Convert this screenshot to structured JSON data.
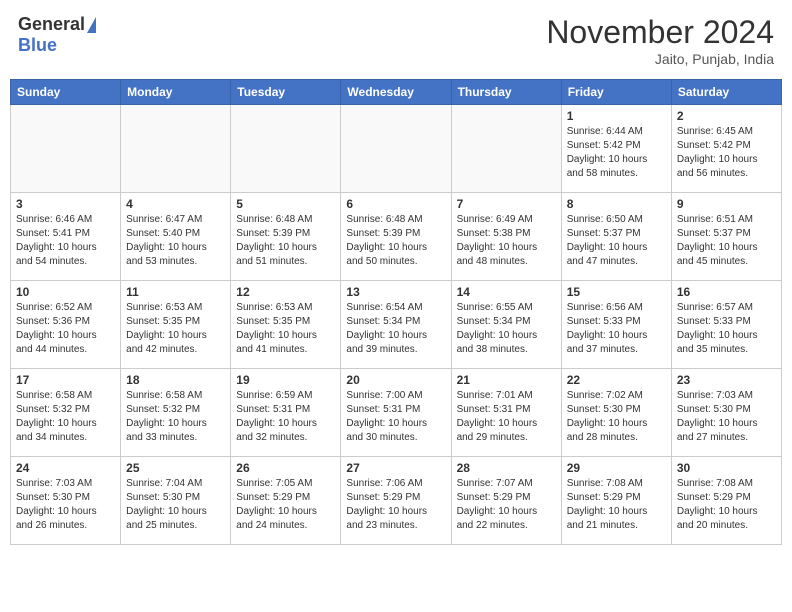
{
  "header": {
    "logo_general": "General",
    "logo_blue": "Blue",
    "month_title": "November 2024",
    "location": "Jaito, Punjab, India"
  },
  "weekdays": [
    "Sunday",
    "Monday",
    "Tuesday",
    "Wednesday",
    "Thursday",
    "Friday",
    "Saturday"
  ],
  "weeks": [
    [
      {
        "day": "",
        "info": ""
      },
      {
        "day": "",
        "info": ""
      },
      {
        "day": "",
        "info": ""
      },
      {
        "day": "",
        "info": ""
      },
      {
        "day": "",
        "info": ""
      },
      {
        "day": "1",
        "info": "Sunrise: 6:44 AM\nSunset: 5:42 PM\nDaylight: 10 hours\nand 58 minutes."
      },
      {
        "day": "2",
        "info": "Sunrise: 6:45 AM\nSunset: 5:42 PM\nDaylight: 10 hours\nand 56 minutes."
      }
    ],
    [
      {
        "day": "3",
        "info": "Sunrise: 6:46 AM\nSunset: 5:41 PM\nDaylight: 10 hours\nand 54 minutes."
      },
      {
        "day": "4",
        "info": "Sunrise: 6:47 AM\nSunset: 5:40 PM\nDaylight: 10 hours\nand 53 minutes."
      },
      {
        "day": "5",
        "info": "Sunrise: 6:48 AM\nSunset: 5:39 PM\nDaylight: 10 hours\nand 51 minutes."
      },
      {
        "day": "6",
        "info": "Sunrise: 6:48 AM\nSunset: 5:39 PM\nDaylight: 10 hours\nand 50 minutes."
      },
      {
        "day": "7",
        "info": "Sunrise: 6:49 AM\nSunset: 5:38 PM\nDaylight: 10 hours\nand 48 minutes."
      },
      {
        "day": "8",
        "info": "Sunrise: 6:50 AM\nSunset: 5:37 PM\nDaylight: 10 hours\nand 47 minutes."
      },
      {
        "day": "9",
        "info": "Sunrise: 6:51 AM\nSunset: 5:37 PM\nDaylight: 10 hours\nand 45 minutes."
      }
    ],
    [
      {
        "day": "10",
        "info": "Sunrise: 6:52 AM\nSunset: 5:36 PM\nDaylight: 10 hours\nand 44 minutes."
      },
      {
        "day": "11",
        "info": "Sunrise: 6:53 AM\nSunset: 5:35 PM\nDaylight: 10 hours\nand 42 minutes."
      },
      {
        "day": "12",
        "info": "Sunrise: 6:53 AM\nSunset: 5:35 PM\nDaylight: 10 hours\nand 41 minutes."
      },
      {
        "day": "13",
        "info": "Sunrise: 6:54 AM\nSunset: 5:34 PM\nDaylight: 10 hours\nand 39 minutes."
      },
      {
        "day": "14",
        "info": "Sunrise: 6:55 AM\nSunset: 5:34 PM\nDaylight: 10 hours\nand 38 minutes."
      },
      {
        "day": "15",
        "info": "Sunrise: 6:56 AM\nSunset: 5:33 PM\nDaylight: 10 hours\nand 37 minutes."
      },
      {
        "day": "16",
        "info": "Sunrise: 6:57 AM\nSunset: 5:33 PM\nDaylight: 10 hours\nand 35 minutes."
      }
    ],
    [
      {
        "day": "17",
        "info": "Sunrise: 6:58 AM\nSunset: 5:32 PM\nDaylight: 10 hours\nand 34 minutes."
      },
      {
        "day": "18",
        "info": "Sunrise: 6:58 AM\nSunset: 5:32 PM\nDaylight: 10 hours\nand 33 minutes."
      },
      {
        "day": "19",
        "info": "Sunrise: 6:59 AM\nSunset: 5:31 PM\nDaylight: 10 hours\nand 32 minutes."
      },
      {
        "day": "20",
        "info": "Sunrise: 7:00 AM\nSunset: 5:31 PM\nDaylight: 10 hours\nand 30 minutes."
      },
      {
        "day": "21",
        "info": "Sunrise: 7:01 AM\nSunset: 5:31 PM\nDaylight: 10 hours\nand 29 minutes."
      },
      {
        "day": "22",
        "info": "Sunrise: 7:02 AM\nSunset: 5:30 PM\nDaylight: 10 hours\nand 28 minutes."
      },
      {
        "day": "23",
        "info": "Sunrise: 7:03 AM\nSunset: 5:30 PM\nDaylight: 10 hours\nand 27 minutes."
      }
    ],
    [
      {
        "day": "24",
        "info": "Sunrise: 7:03 AM\nSunset: 5:30 PM\nDaylight: 10 hours\nand 26 minutes."
      },
      {
        "day": "25",
        "info": "Sunrise: 7:04 AM\nSunset: 5:30 PM\nDaylight: 10 hours\nand 25 minutes."
      },
      {
        "day": "26",
        "info": "Sunrise: 7:05 AM\nSunset: 5:29 PM\nDaylight: 10 hours\nand 24 minutes."
      },
      {
        "day": "27",
        "info": "Sunrise: 7:06 AM\nSunset: 5:29 PM\nDaylight: 10 hours\nand 23 minutes."
      },
      {
        "day": "28",
        "info": "Sunrise: 7:07 AM\nSunset: 5:29 PM\nDaylight: 10 hours\nand 22 minutes."
      },
      {
        "day": "29",
        "info": "Sunrise: 7:08 AM\nSunset: 5:29 PM\nDaylight: 10 hours\nand 21 minutes."
      },
      {
        "day": "30",
        "info": "Sunrise: 7:08 AM\nSunset: 5:29 PM\nDaylight: 10 hours\nand 20 minutes."
      }
    ]
  ]
}
